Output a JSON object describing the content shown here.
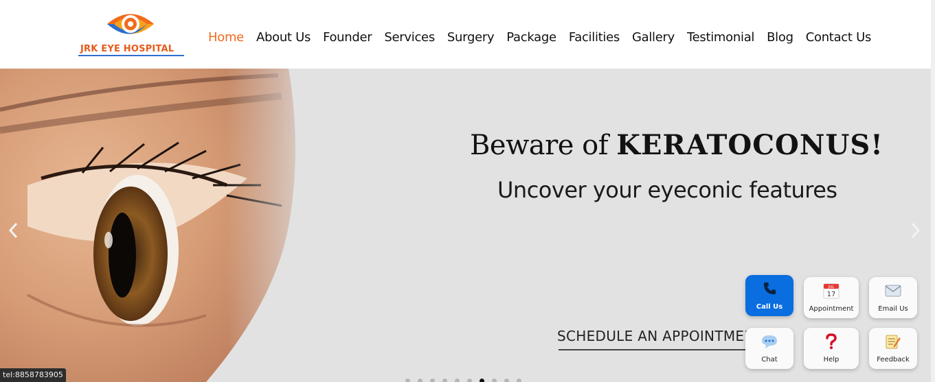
{
  "brand": {
    "name": "JRK EYE HOSPITAL"
  },
  "nav": {
    "items": [
      {
        "label": "Home",
        "active": true
      },
      {
        "label": "About Us"
      },
      {
        "label": "Founder"
      },
      {
        "label": "Services"
      },
      {
        "label": "Surgery"
      },
      {
        "label": "Package"
      },
      {
        "label": "Facilities"
      },
      {
        "label": "Gallery"
      },
      {
        "label": "Testimonial"
      },
      {
        "label": "Blog"
      },
      {
        "label": "Contact Us"
      }
    ]
  },
  "hero": {
    "headline_prefix": "Beware of ",
    "headline_emphasis": "KERATOCONUS!",
    "subline": "Uncover your eyeconic features",
    "cta": "SCHEDULE AN APPOINTMENT",
    "slides_total": 10,
    "active_slide": 7
  },
  "widget": {
    "call": "Call Us",
    "appointment": "Appointment",
    "calendar_month": "JUL",
    "calendar_day": "17",
    "email": "Email Us",
    "chat": "Chat",
    "help": "Help",
    "feedback": "Feedback"
  },
  "status_bar": {
    "link": "tel:8858783905"
  },
  "colors": {
    "accent": "#f26a1b",
    "brand_blue": "#2d6fcf",
    "call_button": "#0a6de0",
    "hero_bg": "#e2e2e2"
  }
}
